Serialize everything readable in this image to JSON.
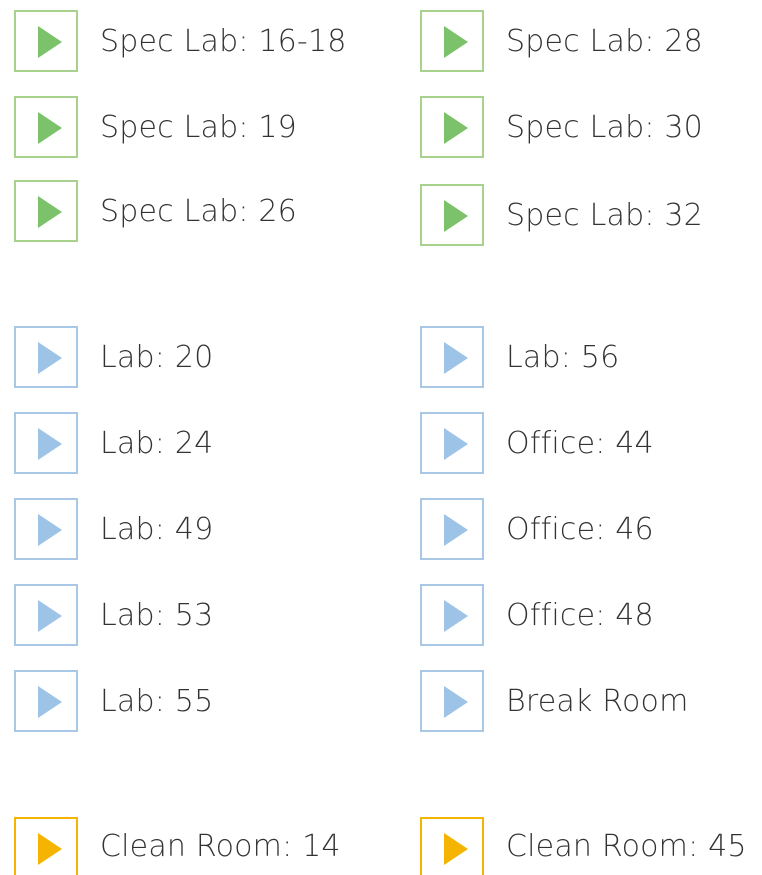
{
  "colors": {
    "green_border": "#a9d18e",
    "green_play": "#7cc26a",
    "blue_border": "#a8c8e6",
    "blue_play": "#9dc3e6",
    "yellow_border": "#f5b400",
    "yellow_play": "#f5b400",
    "text": "#333333"
  },
  "icon": "play-icon",
  "spec_labs": {
    "left": [
      "Spec Lab: 16-18",
      "Spec Lab: 19",
      "Spec Lab: 26"
    ],
    "right": [
      "Spec Lab: 28",
      "Spec Lab: 30",
      "Spec Lab: 32"
    ]
  },
  "labs": {
    "left": [
      "Lab: 20",
      "Lab: 24",
      "Lab: 49",
      "Lab: 53",
      "Lab: 55"
    ],
    "right": [
      "Lab: 56",
      "Office: 44",
      "Office: 46",
      "Office: 48",
      "Break Room"
    ]
  },
  "clean_rooms": {
    "left": [
      "Clean Room: 14"
    ],
    "right": [
      "Clean Room: 45"
    ]
  }
}
